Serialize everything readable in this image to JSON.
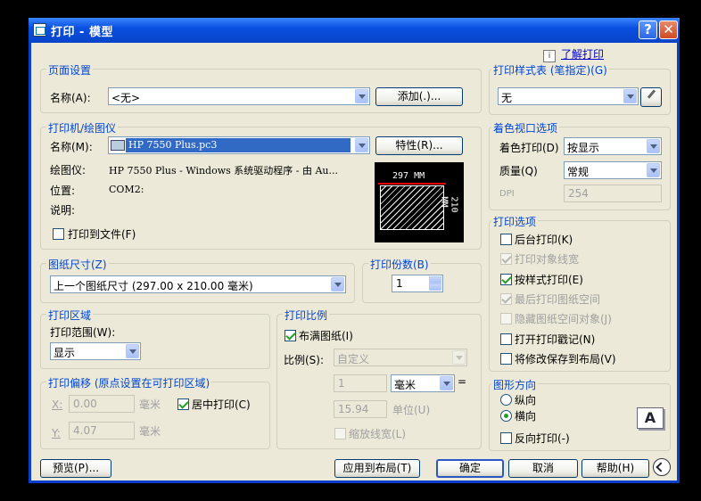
{
  "window": {
    "title": "打印 - 模型",
    "help_label": "?",
    "close_label": "✕"
  },
  "learn_link": "了解打印",
  "page_setup": {
    "group_label": "页面设置",
    "name_label": "名称(A):",
    "name_value": "<无>",
    "add_button": "添加(.)..."
  },
  "printer": {
    "group_label": "打印机/绘图仪",
    "name_label": "名称(M):",
    "name_value": "HP 7550 Plus.pc3",
    "properties_button": "特性(R)...",
    "plotter_label": "绘图仪:",
    "plotter_value": "HP 7550 Plus - Windows 系统驱动程序 - 由 Au...",
    "location_label": "位置:",
    "location_value": "COM2:",
    "description_label": "说明:",
    "print_to_file_label": "打印到文件(F)",
    "preview_width": "297 MM",
    "preview_height": "210 MM"
  },
  "paper_size": {
    "group_label": "图纸尺寸(Z)",
    "value": "上一个图纸尺寸  (297.00 x 210.00 毫米)"
  },
  "copies": {
    "group_label": "打印份数(B)",
    "value": "1"
  },
  "plot_area": {
    "group_label": "打印区域",
    "range_label": "打印范围(W):",
    "range_value": "显示"
  },
  "plot_offset": {
    "group_label": "打印偏移 (原点设置在可打印区域)",
    "x_label": "X:",
    "x_value": "0.00",
    "x_unit": "毫米",
    "y_label": "Y:",
    "y_value": "4.07",
    "y_unit": "毫米",
    "center_label": "居中打印(C)"
  },
  "plot_scale": {
    "group_label": "打印比例",
    "fit_label": "布满图纸(I)",
    "scale_label": "比例(S):",
    "scale_value": "自定义",
    "num_value": "1",
    "unit_value": "毫米",
    "equals": "=",
    "unit_num_value": "15.94",
    "unit_label": "单位(U)",
    "lineweights_label": "缩放线宽(L)"
  },
  "style_table": {
    "group_label": "打印样式表 (笔指定)(G)",
    "value": "无"
  },
  "shaded": {
    "group_label": "着色视口选项",
    "shade_label": "着色打印(D)",
    "shade_value": "按显示",
    "quality_label": "质量(Q)",
    "quality_value": "常规",
    "dpi_label": "DPI",
    "dpi_value": "254"
  },
  "options": {
    "group_label": "打印选项",
    "items": [
      "后台打印(K)",
      "打印对象线宽",
      "按样式打印(E)",
      "最后打印图纸空间",
      "隐藏图纸空间对象(J)",
      "打开打印戳记(N)",
      "将修改保存到布局(V)"
    ]
  },
  "orientation": {
    "group_label": "图形方向",
    "portrait": "纵向",
    "landscape": "横向",
    "reverse": "反向打印(-)",
    "icon_letter": "A"
  },
  "buttons": {
    "preview": "预览(P)...",
    "apply": "应用到布局(T)",
    "ok": "确定",
    "cancel": "取消",
    "help": "帮助(H)"
  }
}
